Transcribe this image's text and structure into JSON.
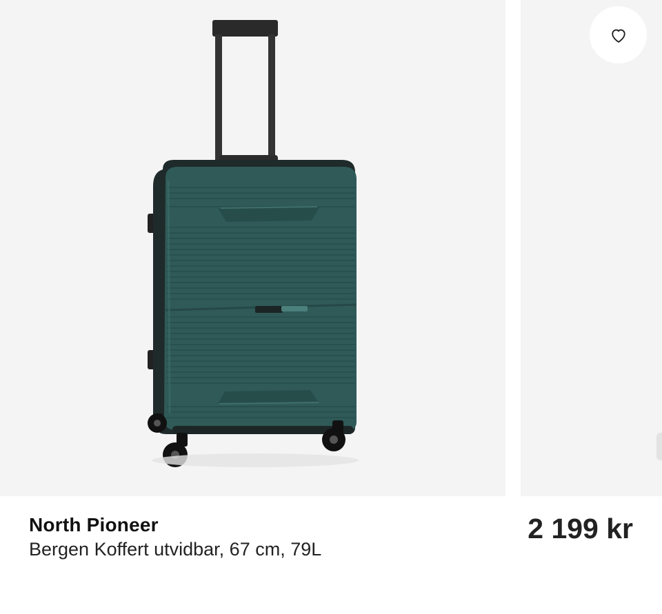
{
  "product": {
    "brand": "North Pioneer",
    "name": "Bergen Koffert utvidbar, 67 cm, 79L",
    "price": "2 199 kr",
    "color": "#2f5a58"
  },
  "gallery": {
    "main_image": "suitcase-photo",
    "next_image": "suitcase-photo-partial"
  },
  "actions": {
    "favorite_icon": "heart-icon"
  }
}
